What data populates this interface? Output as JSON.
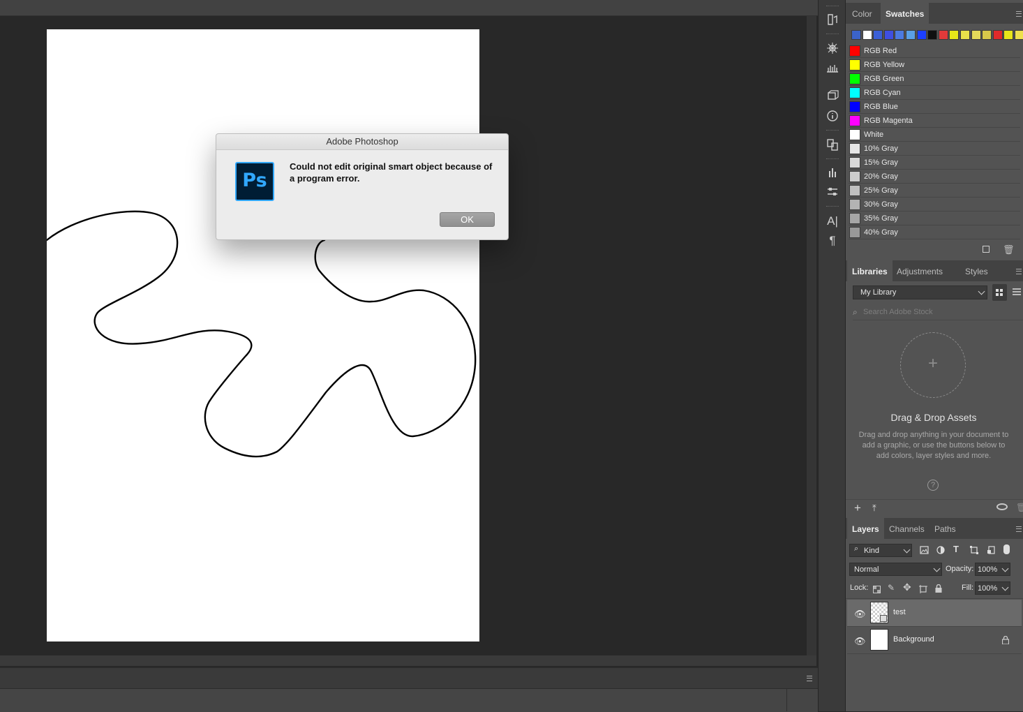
{
  "dialog": {
    "title": "Adobe Photoshop",
    "app_icon_text": "Ps",
    "message": "Could not edit original smart object because of a program error.",
    "ok_label": "OK"
  },
  "swatches_panel": {
    "tabs": [
      "Color",
      "Swatches"
    ],
    "active_tab": "Swatches",
    "recent_colors": [
      "#3b63c9",
      "#ffffff",
      "#3b5fd6",
      "#3f4fe0",
      "#4c7ae0",
      "#5aa0e6",
      "#1c3fff",
      "#101010",
      "#e03a3a",
      "#e6e619",
      "#e8e04a",
      "#e3d95a",
      "#d8c84a",
      "#e02a2a",
      "#e8e619",
      "#eee04e"
    ],
    "items": [
      {
        "name": "RGB Red",
        "color": "#ff0000"
      },
      {
        "name": "RGB Yellow",
        "color": "#ffff00"
      },
      {
        "name": "RGB Green",
        "color": "#00ff00"
      },
      {
        "name": "RGB Cyan",
        "color": "#00ffff"
      },
      {
        "name": "RGB Blue",
        "color": "#0000ff"
      },
      {
        "name": "RGB Magenta",
        "color": "#ff00ff"
      },
      {
        "name": "White",
        "color": "#ffffff"
      },
      {
        "name": "10% Gray",
        "color": "#e6e6e6"
      },
      {
        "name": "15% Gray",
        "color": "#d9d9d9"
      },
      {
        "name": "20% Gray",
        "color": "#cccccc"
      },
      {
        "name": "25% Gray",
        "color": "#bfbfbf"
      },
      {
        "name": "30% Gray",
        "color": "#b3b3b3"
      },
      {
        "name": "35% Gray",
        "color": "#a6a6a6"
      },
      {
        "name": "40% Gray",
        "color": "#999999"
      }
    ]
  },
  "libraries_panel": {
    "tabs": [
      "Libraries",
      "Adjustments",
      "Styles"
    ],
    "active_tab": "Libraries",
    "library_select": "My Library",
    "search_placeholder": "Search Adobe Stock",
    "drop_title": "Drag & Drop Assets",
    "drop_text": "Drag and drop anything in your document to add a graphic, or use the buttons below to add colors, layer styles and more."
  },
  "layers_panel": {
    "tabs": [
      "Layers",
      "Channels",
      "Paths"
    ],
    "active_tab": "Layers",
    "filter_kind": "Kind",
    "blend_mode": "Normal",
    "opacity_label": "Opacity:",
    "opacity_value": "100%",
    "lock_label": "Lock:",
    "fill_label": "Fill:",
    "fill_value": "100%",
    "layers": [
      {
        "name": "test",
        "selected": true,
        "smart_object": true
      },
      {
        "name": "Background",
        "selected": false,
        "locked": true
      }
    ]
  },
  "colors": {
    "workspace_bg": "#282828",
    "panel_bg": "#535353",
    "ps_brand": "#31a8ff"
  }
}
